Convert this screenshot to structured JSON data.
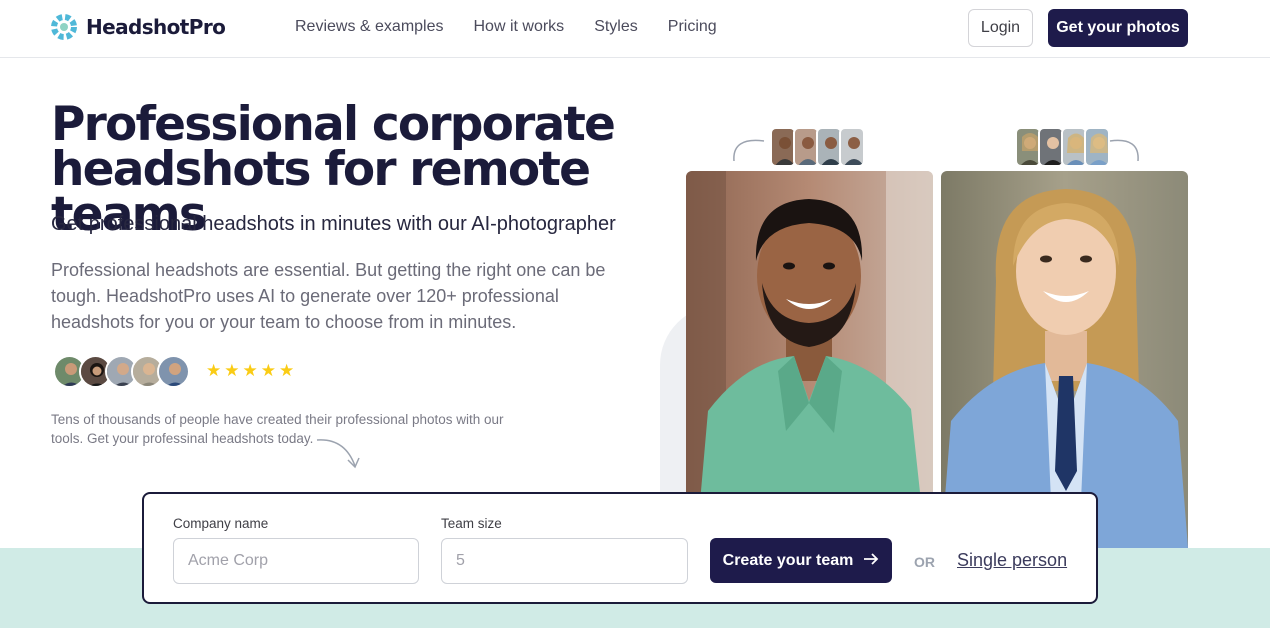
{
  "brand": {
    "name": "HeadshotPro",
    "accent": "#1e1b4b",
    "logo_colors": [
      "#4fb8d8",
      "#8fd3c4"
    ]
  },
  "nav": {
    "links": [
      "Reviews & examples",
      "How it works",
      "Styles",
      "Pricing"
    ],
    "login_label": "Login",
    "cta_label": "Get your photos"
  },
  "hero": {
    "title": "Professional corporate headshots for remote teams",
    "subtitle": "Get professional headshots in minutes with our AI-photographer",
    "description": "Professional headshots are essential. But getting the right one can be tough. HeadshotPro uses AI to generate over 120+ professional headshots for you or your team to choose from in minutes.",
    "rating_stars": 5,
    "social_note": "Tens of thousands of people have created their professional photos with our tools. Get your professinal headshots today."
  },
  "form": {
    "company_label": "Company name",
    "company_placeholder": "Acme Corp",
    "team_label": "Team size",
    "team_placeholder": "5",
    "create_label": "Create your team",
    "or_label": "OR",
    "single_label": "Single person"
  },
  "colors": {
    "band": "#d0ebe6",
    "star": "#facc15"
  }
}
